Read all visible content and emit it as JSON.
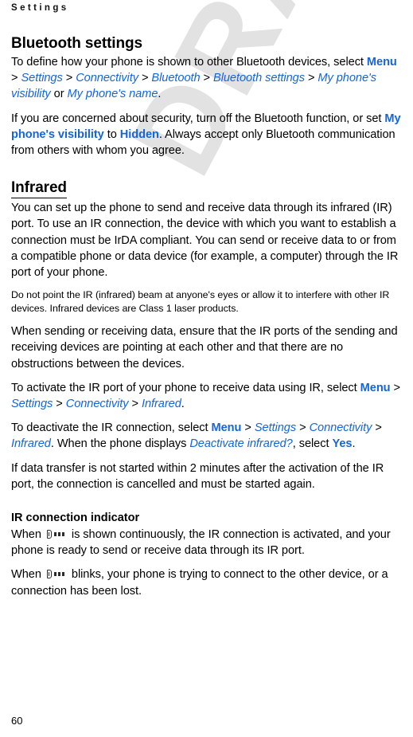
{
  "page": {
    "running_header": "Settings",
    "folio": "60",
    "watermark_text": "DRAFT",
    "accent_color": "#1565d8",
    "watermark_color": "#e2e2e2"
  },
  "sections": {
    "bluetooth": {
      "heading": "Bluetooth settings",
      "p1": {
        "lead": "To define how your phone is shown to other Bluetooth devices, select ",
        "path": [
          "Menu",
          "Settings",
          "Connectivity",
          "Bluetooth",
          "Bluetooth settings",
          "My phone's visibility"
        ],
        "mid": " or ",
        "alt": "My phone's name",
        "tail": "."
      },
      "p2": {
        "lead": "If you are concerned about security, turn off the Bluetooth function, or set ",
        "term1": "My phone's visibility",
        "mid1": " to ",
        "term2": "Hidden",
        "tail": ". Always accept only Bluetooth communication from others with whom you agree."
      }
    },
    "infrared": {
      "heading": "Infrared",
      "p1": "You can set up the phone to send and receive data through its infrared (IR) port. To use an IR connection, the device with which you want to establish a connection must be IrDA compliant. You can send or receive data to or from a compatible phone or data device (for example, a computer) through the IR port of your phone.",
      "note": "Do not point the IR (infrared) beam at anyone's eyes or allow it to interfere with other IR devices. Infrared devices are Class 1 laser products.",
      "p2": "When sending or receiving data, ensure that the IR ports of the sending and receiving devices are pointing at each other and that there are no obstructions between the devices.",
      "p3": {
        "lead": "To activate the IR port of your phone to receive data using IR, select ",
        "path": [
          "Menu",
          "Settings",
          "Connectivity",
          "Infrared"
        ],
        "tail": "."
      },
      "p4": {
        "lead": "To deactivate the IR connection, select ",
        "path": [
          "Menu",
          "Settings",
          "Connectivity",
          "Infrared"
        ],
        "mid": ". When the phone displays ",
        "prompt": "Deactivate infrared?",
        "mid2": ", select ",
        "confirm": "Yes",
        "tail": "."
      },
      "p5": "If data transfer is not started within 2 minutes after the activation of the IR port, the connection is cancelled and must be started again."
    },
    "ir_indicator": {
      "heading": "IR connection indicator",
      "p1": {
        "lead": "When ",
        "icon": "ir-beam-icon",
        "tail": " is shown continuously, the IR connection is activated, and your phone is ready to send or receive data through its IR port."
      },
      "p2": {
        "lead": "When ",
        "icon": "ir-beam-icon",
        "tail": " blinks, your phone is trying to connect to the other device, or a connection has been lost."
      }
    }
  }
}
